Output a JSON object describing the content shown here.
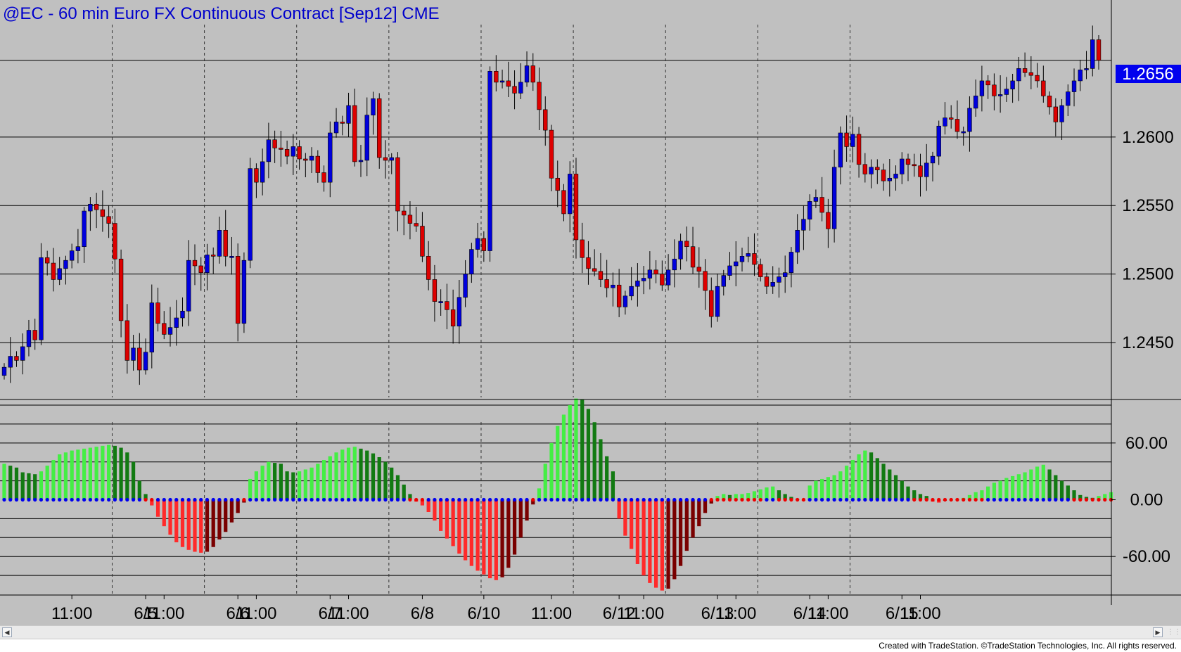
{
  "header": {
    "title": "@EC - 60 min  Euro FX Continuous Contract [Sep12]  CME"
  },
  "price_panel": {
    "last_price_label": "1.2656",
    "last_price": 1.2656,
    "y_ticks": [
      "1.2600",
      "1.2550",
      "1.2500",
      "1.2450"
    ],
    "y_tick_values": [
      1.26,
      1.255,
      1.25,
      1.245
    ],
    "ylim": [
      1.241,
      1.27
    ]
  },
  "indicator_panel": {
    "y_ticks": [
      "60.00",
      "0.00",
      "-60.00"
    ],
    "y_tick_values": [
      60,
      0,
      -60
    ],
    "ylim": [
      -100,
      103
    ]
  },
  "x_axis": {
    "labels": [
      "11:00",
      "6/5",
      "11:00",
      "6/6",
      "11:00",
      "6/7",
      "11:00",
      "6/8",
      "6/10",
      "11:00",
      "6/12",
      "11:00",
      "6/13",
      "11:00",
      "6/14",
      "11:00",
      "6/15",
      "11:00"
    ],
    "label_bar_index": [
      11,
      23,
      26,
      38,
      41,
      53,
      56,
      68,
      78,
      89,
      100,
      104,
      116,
      119,
      131,
      134,
      146,
      149
    ],
    "session_bar_index": [
      18,
      33,
      48,
      63,
      78,
      93,
      108,
      123,
      138
    ]
  },
  "colors": {
    "background": "#c0c0c0",
    "up_candle": "#0000dd",
    "down_candle": "#dd0000",
    "hist_bright_green": "#44ee44",
    "hist_dark_green": "#127a12",
    "hist_bright_red": "#ff2a2a",
    "hist_dark_red": "#7a0000",
    "title_text": "#0000cc",
    "last_price_bg": "#0000ee"
  },
  "footer": {
    "credit": "Created with TradeStation. ©TradeStation Technologies, Inc. All rights reserved."
  },
  "chart_data": [
    {
      "type": "candlestick",
      "title": "@EC - 60 min  Euro FX Continuous Contract [Sep12]  CME",
      "ylim": [
        1.241,
        1.27
      ],
      "x_labels": [
        "11:00",
        "6/5",
        "11:00",
        "6/6",
        "11:00",
        "6/7",
        "11:00",
        "6/8",
        "6/10",
        "11:00",
        "6/12",
        "11:00",
        "6/13",
        "11:00",
        "6/14",
        "11:00",
        "6/15",
        "11:00"
      ],
      "closes": [
        1.2432,
        1.244,
        1.2437,
        1.2447,
        1.2459,
        1.2452,
        1.2512,
        1.2508,
        1.2496,
        1.2504,
        1.251,
        1.2517,
        1.252,
        1.2546,
        1.2551,
        1.2547,
        1.2542,
        1.2537,
        1.2511,
        1.2466,
        1.2437,
        1.2446,
        1.243,
        1.2443,
        1.2479,
        1.2464,
        1.2456,
        1.2461,
        1.2468,
        1.2473,
        1.251,
        1.2506,
        1.2501,
        1.2514,
        1.2513,
        1.2532,
        1.2513,
        1.2513,
        1.2464,
        1.251,
        1.2577,
        1.2567,
        1.2582,
        1.2598,
        1.2592,
        1.2591,
        1.2586,
        1.2593,
        1.2584,
        1.2583,
        1.2586,
        1.2574,
        1.2567,
        1.2603,
        1.2611,
        1.261,
        1.2623,
        1.2582,
        1.2583,
        1.2616,
        1.2628,
        1.2585,
        1.2583,
        1.2585,
        1.2546,
        1.2543,
        1.2537,
        1.2535,
        1.2513,
        1.2496,
        1.248,
        1.248,
        1.2474,
        1.2462,
        1.2483,
        1.25,
        1.2518,
        1.2526,
        1.2517,
        1.2648,
        1.264,
        1.2641,
        1.2637,
        1.2632,
        1.264,
        1.2652,
        1.264,
        1.262,
        1.2605,
        1.257,
        1.2561,
        1.2544,
        1.2573,
        1.2525,
        1.2512,
        1.2504,
        1.2502,
        1.2496,
        1.249,
        1.2492,
        1.2476,
        1.2484,
        1.2491,
        1.2495,
        1.2497,
        1.2503,
        1.25,
        1.2492,
        1.2503,
        1.2511,
        1.2524,
        1.252,
        1.2505,
        1.2502,
        1.2488,
        1.2469,
        1.2491,
        1.2499,
        1.2506,
        1.2509,
        1.2513,
        1.2515,
        1.2507,
        1.2498,
        1.2491,
        1.2494,
        1.2498,
        1.2501,
        1.2516,
        1.2532,
        1.254,
        1.2553,
        1.2556,
        1.2545,
        1.2533,
        1.2578,
        1.2603,
        1.2593,
        1.2602,
        1.258,
        1.2573,
        1.2578,
        1.2576,
        1.2568,
        1.257,
        1.2573,
        1.2584,
        1.258,
        1.2579,
        1.2571,
        1.2581,
        1.2586,
        1.2608,
        1.2614,
        1.2613,
        1.2604,
        1.2604,
        1.2621,
        1.263,
        1.2641,
        1.2638,
        1.263,
        1.2631,
        1.2635,
        1.2641,
        1.265,
        1.2647,
        1.2645,
        1.2641,
        1.263,
        1.2622,
        1.2611,
        1.2623,
        1.2633,
        1.2641,
        1.2649,
        1.265,
        1.2671,
        1.2656
      ]
    },
    {
      "type": "bar",
      "title": "",
      "ylim": [
        -100,
        103
      ],
      "values": [
        38,
        36,
        34,
        29,
        28,
        27,
        30,
        36,
        42,
        48,
        50,
        52,
        53,
        54,
        55,
        56,
        57,
        58,
        57,
        55,
        50,
        40,
        20,
        6,
        -6,
        -18,
        -28,
        -37,
        -45,
        -50,
        -53,
        -55,
        -56,
        -55,
        -50,
        -42,
        -34,
        -24,
        -14,
        -3,
        22,
        30,
        36,
        40,
        39,
        38,
        30,
        29,
        30,
        32,
        34,
        38,
        42,
        46,
        50,
        53,
        55,
        56,
        54,
        52,
        49,
        45,
        40,
        34,
        26,
        16,
        6,
        -2,
        -6,
        -13,
        -22,
        -33,
        -41,
        -49,
        -57,
        -64,
        -70,
        -75,
        -79,
        -83,
        -85,
        -82,
        -72,
        -58,
        -40,
        -22,
        -5,
        12,
        38,
        60,
        78,
        90,
        100,
        107,
        106,
        96,
        82,
        64,
        46,
        30,
        -20,
        -38,
        -52,
        -68,
        -80,
        -88,
        -93,
        -96,
        -94,
        -84,
        -70,
        -54,
        -40,
        -28,
        -14,
        -4,
        4,
        6,
        5,
        6,
        6,
        7,
        9,
        11,
        13,
        14,
        10,
        6,
        3,
        1,
        -1,
        15,
        20,
        22,
        24,
        26,
        30,
        36,
        42,
        48,
        52,
        50,
        44,
        38,
        32,
        26,
        20,
        14,
        10,
        6,
        4,
        -2,
        -3,
        -1,
        0,
        1,
        2,
        5,
        8,
        10,
        14,
        18,
        20,
        23,
        25,
        27,
        29,
        32,
        35,
        37,
        32,
        26,
        20,
        15,
        10,
        5,
        3,
        2,
        4,
        6,
        8
      ]
    }
  ]
}
